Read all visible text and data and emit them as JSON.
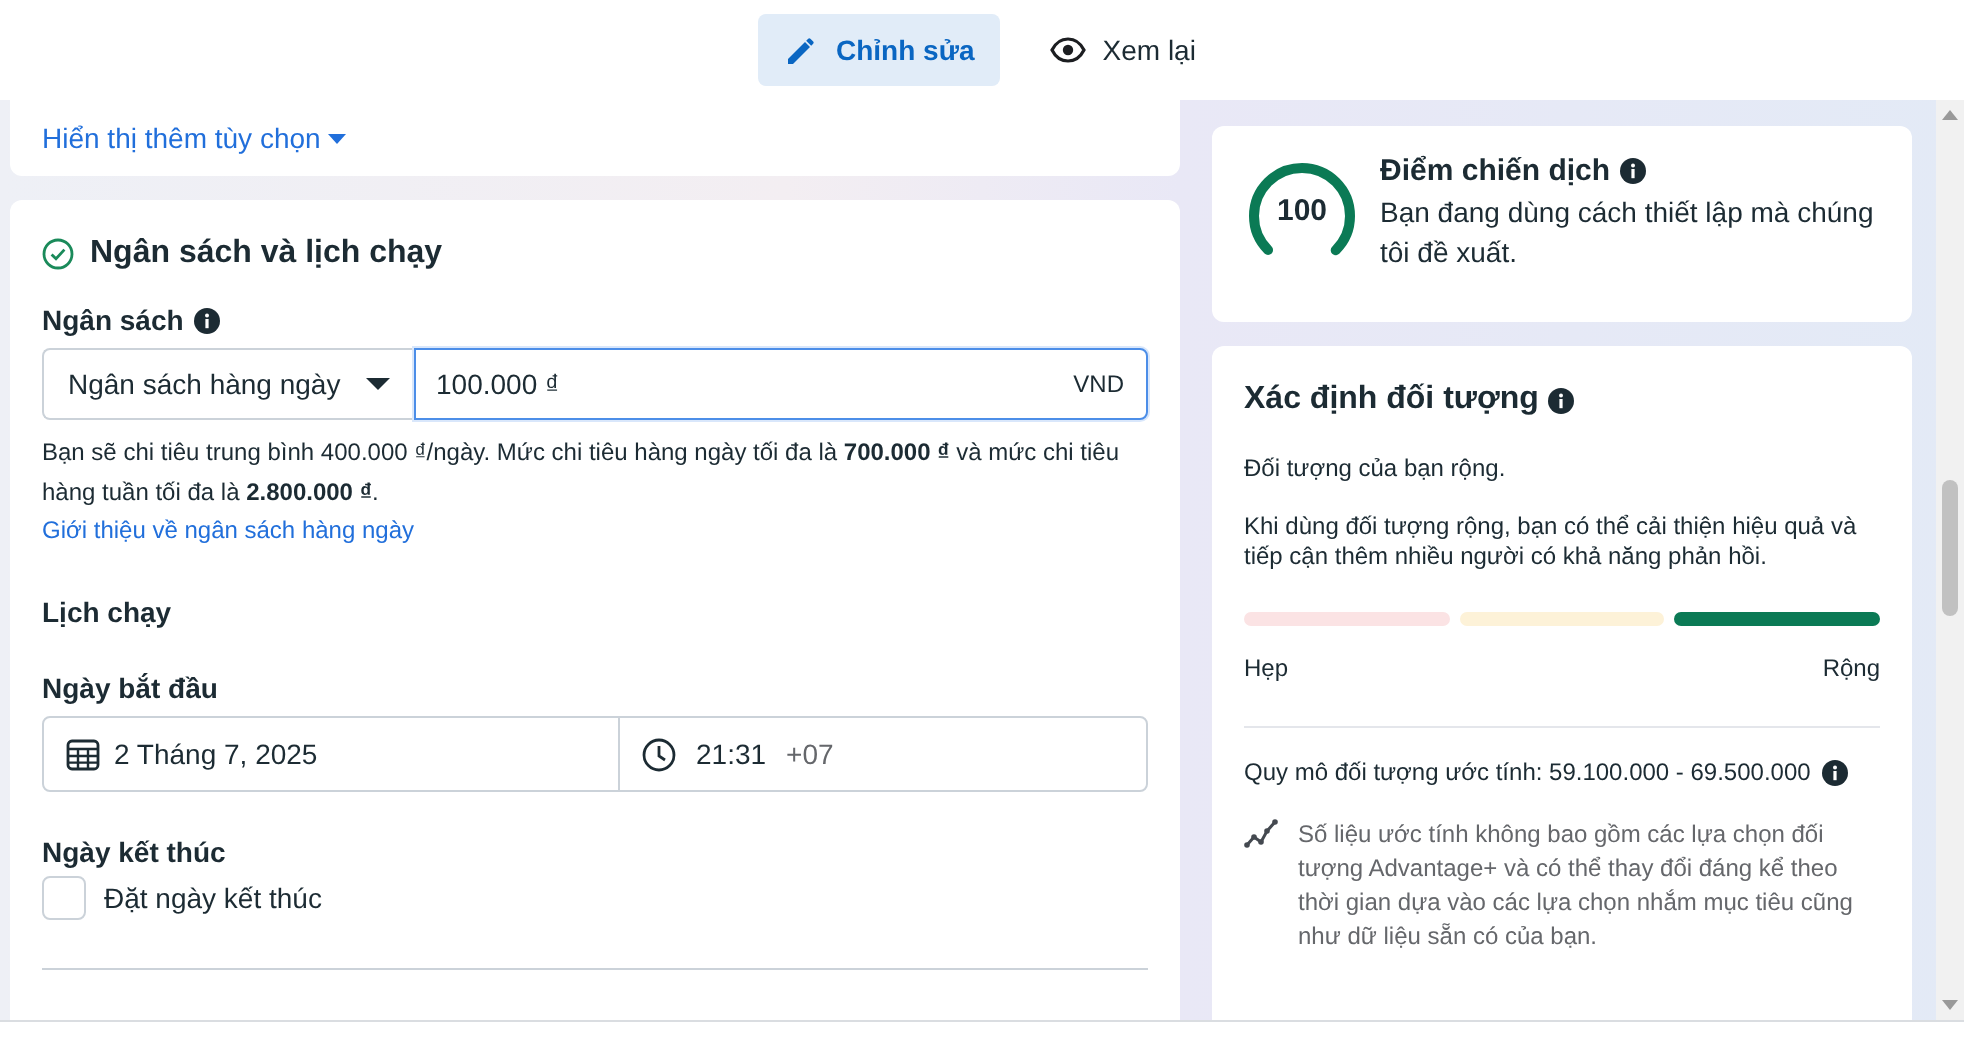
{
  "toolbar": {
    "tabs": [
      {
        "label": "Chỉnh sửa",
        "selected": true
      },
      {
        "label": "Xem lại",
        "selected": false
      }
    ]
  },
  "more_options_link": "Hiển thị thêm tùy chọn",
  "budget_section": {
    "title": "Ngân sách và lịch chạy",
    "complete": true,
    "budget_label": "Ngân sách",
    "budget_type": "Ngân sách hàng ngày",
    "amount": "100.000 ₫",
    "amount_focused": true,
    "currency": "VND",
    "help": "Bạn sẽ chi tiêu trung bình 400.000 ₫/ngày. Mức chi tiêu hàng ngày tối đa là **700.000 ₫** và mức chi tiêu hàng tuần tối đa là **2.800.000 ₫**.",
    "learn_link": "Giới thiệu về ngân sách hàng ngày",
    "schedule_title": "Lịch chạy",
    "start_label": "Ngày bắt đầu",
    "start_date": "2 Tháng 7, 2025",
    "start_time": "21:31",
    "timezone": "+07",
    "end_label": "Ngày kết thúc",
    "end_checkbox": {
      "label": "Đặt ngày kết thúc",
      "checked": false
    }
  },
  "score_card": {
    "score": "100",
    "title": "Điểm chiến dịch",
    "description": "Bạn đang dùng cách thiết lập mà chúng tôi đề xuất."
  },
  "audience_card": {
    "title": "Xác định đối tượng",
    "status": "Đối tượng của bạn rộng.",
    "advice": "Khi dùng đối tượng rộng, bạn có thể cải thiện hiệu quả và tiếp cận thêm nhiều người có khả năng phản hồi.",
    "segments": [
      {
        "selected": false
      },
      {
        "selected": false
      },
      {
        "selected": true
      }
    ],
    "min_label": "Hẹp",
    "max_label": "Rộng",
    "size": "Quy mô đối tượng ước tính: 59.100.000 - 69.500.000",
    "note": "Số liệu ước tính không bao gồm các lựa chọn đối tượng Advantage+ và có thể thay đổi đáng kể theo thời gian dựa vào các lựa chọn nhắm mục tiêu cũng như dữ liệu sẵn có của bạn."
  }
}
